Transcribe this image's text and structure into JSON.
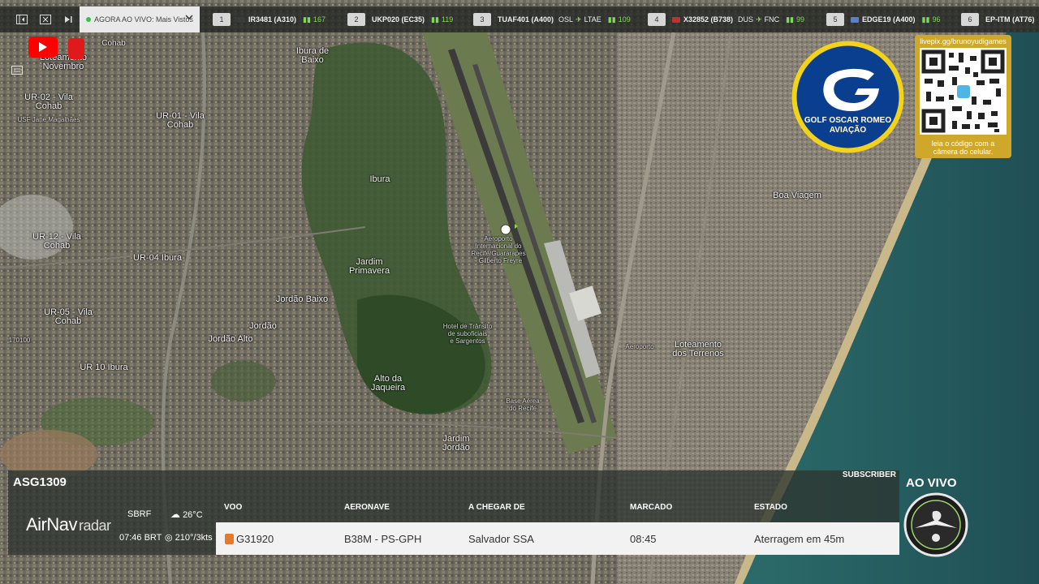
{
  "topbar": {
    "live_label": "AGORA AO VIVO: Mais Vistos",
    "flights": [
      {
        "rank": "1",
        "callsign": "IR3481 (A310)",
        "route": "",
        "from": "",
        "to": "",
        "count": "167",
        "flag_color": "#3a3a3a"
      },
      {
        "rank": "2",
        "callsign": "UKP020 (EC35)",
        "route": "",
        "from": "",
        "to": "",
        "count": "119",
        "flag_color": ""
      },
      {
        "rank": "3",
        "callsign": "TUAF401 (A400)",
        "from": "OSL",
        "to": "LTAE",
        "count": "109",
        "flag_color": ""
      },
      {
        "rank": "4",
        "callsign": "X32852 (B738)",
        "from": "DUS",
        "to": "FNC",
        "count": "99",
        "flag_color": "#c03030"
      },
      {
        "rank": "5",
        "callsign": "EDGE19 (A400)",
        "from": "",
        "to": "",
        "count": "96",
        "flag_color": "#5b7fcf"
      },
      {
        "rank": "6",
        "callsign": "EP-ITM (AT76)",
        "from": "",
        "to": "",
        "count": "",
        "flag_color": ""
      }
    ]
  },
  "map": {
    "labels": [
      {
        "text": "Cohab",
        "cls": ""
      },
      {
        "text": "Loteamento\nNovembro",
        "cls": "big"
      },
      {
        "text": "UR-02 - Vila\nCohab",
        "cls": "big"
      },
      {
        "text": "UR-01 - Vila\nCohab",
        "cls": "big"
      },
      {
        "text": "USF Jane Magalhães",
        "cls": "tiny"
      },
      {
        "text": "Ibura de\nBaixo",
        "cls": "big"
      },
      {
        "text": "Ibura",
        "cls": "big"
      },
      {
        "text": "UR-12 - Vila\nCohab",
        "cls": "big"
      },
      {
        "text": "UR-04 Ibura",
        "cls": "big"
      },
      {
        "text": "UR-05 - Vila\nCohab",
        "cls": "big"
      },
      {
        "text": "UR 10 Ibura",
        "cls": "big"
      },
      {
        "text": "Jordão Baixo",
        "cls": "big"
      },
      {
        "text": "Jordão",
        "cls": "big"
      },
      {
        "text": "Jordão Alto",
        "cls": "big"
      },
      {
        "text": "Jardim\nPrimavera",
        "cls": "big"
      },
      {
        "text": "Alto da\nJaqueira",
        "cls": "big"
      },
      {
        "text": "Aeroporto\nInternacional do\nRecife/Guararapes\n- Gilberto Freyre",
        "cls": "tiny"
      },
      {
        "text": "Hotel de Trânsito\nde suboficiais\ne Sargentos",
        "cls": "tiny"
      },
      {
        "text": "Base Aérea\ndo Recife",
        "cls": "tiny"
      },
      {
        "text": "Jardim\nJordão",
        "cls": "big"
      },
      {
        "text": "Boa Viagem",
        "cls": "big"
      },
      {
        "text": "Loteamento\ndos Terrenos",
        "cls": "big"
      },
      {
        "text": "Aeroporto",
        "cls": "tiny"
      },
      {
        "text": "170100",
        "cls": "tiny"
      }
    ]
  },
  "logos": {
    "gor_title": "GOLF OSCAR ROMEO\nAVIAÇÃO",
    "qr_url": "livepix.gg/brunoyudigames",
    "qr_caption": "leia o código com a\ncâmera do celular."
  },
  "panel": {
    "flight_id": "ASG1309",
    "subscriber": "SUBSCRIBER",
    "brand_main": "AirNav",
    "brand_sub": "radar",
    "airport": "SBRF",
    "time": "07:46 BRT",
    "temp": "26°C",
    "wind": "210°/3kts",
    "headers": {
      "voo": "VOO",
      "aeronave": "AERONAVE",
      "origem": "A CHEGAR DE",
      "marcado": "MARCADO",
      "estado": "ESTADO"
    },
    "row": {
      "voo": "G31920",
      "aeronave": "B38M - PS-GPH",
      "origem": "Salvador SSA",
      "marcado": "08:45",
      "estado": "Aterragem em 45m"
    }
  },
  "live_badge": "AO VIVO",
  "colors": {
    "accent": "#35c14a",
    "youtube": "#ff0000",
    "qr_gold": "#cfa82b",
    "gor_blue": "#0a3f8f",
    "gor_yellow": "#f2d21b"
  }
}
